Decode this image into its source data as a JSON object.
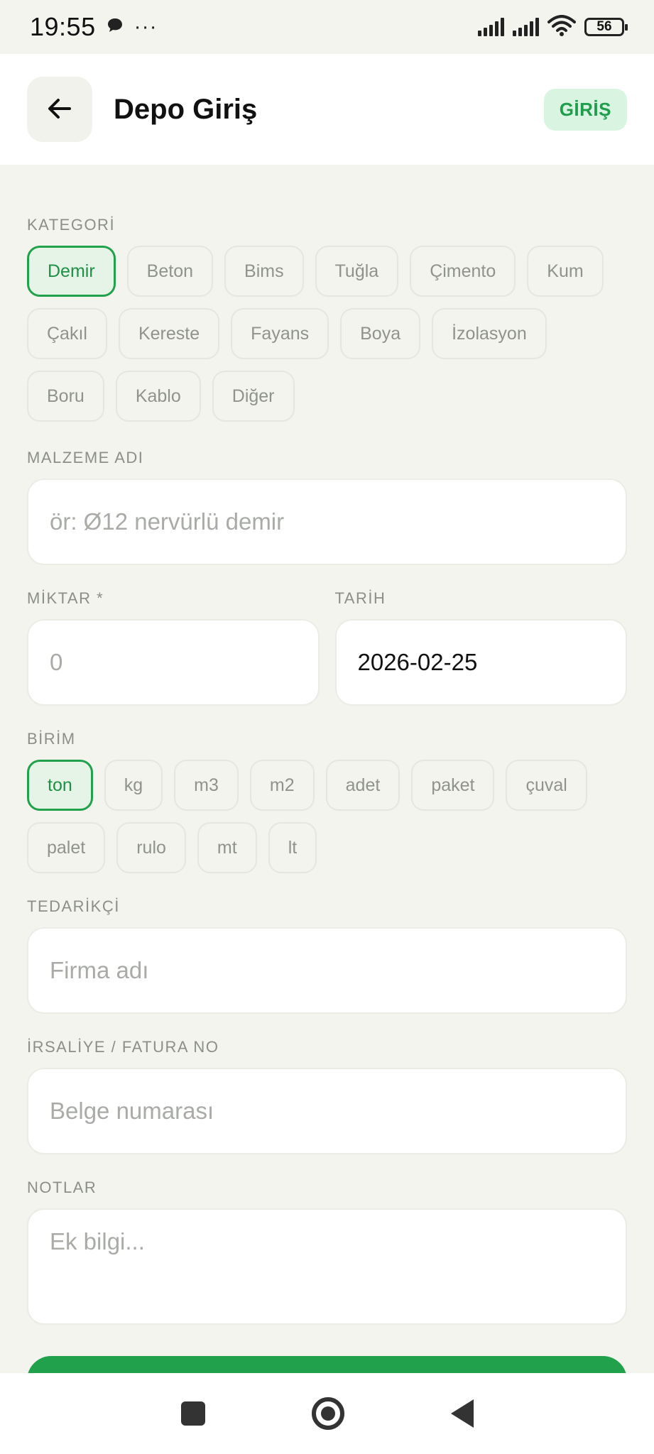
{
  "status_bar": {
    "time": "19:55",
    "dots": "···",
    "battery": "56"
  },
  "header": {
    "title": "Depo Giriş",
    "badge": "GİRİŞ"
  },
  "category": {
    "label": "KATEGORİ",
    "selected": "Demir",
    "items": [
      "Demir",
      "Beton",
      "Bims",
      "Tuğla",
      "Çimento",
      "Kum",
      "Çakıl",
      "Kereste",
      "Fayans",
      "Boya",
      "İzolasyon",
      "Boru",
      "Kablo",
      "Diğer"
    ]
  },
  "material": {
    "label": "MALZEME ADI",
    "placeholder": "ör: Ø12 nervürlü demir",
    "value": ""
  },
  "quantity": {
    "label": "MİKTAR *",
    "placeholder": "0",
    "value": ""
  },
  "date": {
    "label": "TARİH",
    "value": "2026-02-25"
  },
  "unit": {
    "label": "BİRİM",
    "selected": "ton",
    "items": [
      "ton",
      "kg",
      "m3",
      "m2",
      "adet",
      "paket",
      "çuval",
      "palet",
      "rulo",
      "mt",
      "lt"
    ]
  },
  "supplier": {
    "label": "TEDARİKÇİ",
    "placeholder": "Firma adı",
    "value": ""
  },
  "invoice": {
    "label": "İRSALİYE / FATURA NO",
    "placeholder": "Belge numarası",
    "value": ""
  },
  "notes": {
    "label": "NOTLAR",
    "placeholder": "Ek bilgi...",
    "value": ""
  },
  "colors": {
    "accent": "#22a14d",
    "accent_bg": "#e6f4e8",
    "badge_bg": "#d9f5e2"
  }
}
